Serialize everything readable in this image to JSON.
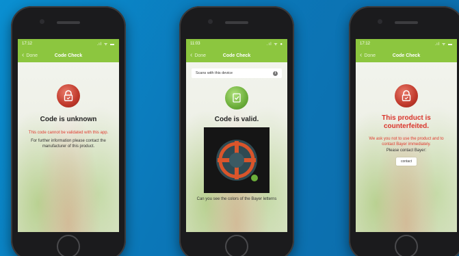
{
  "phones": [
    {
      "status_time": "17:12",
      "status_icons": ".ıl ᯤ ▬",
      "nav_back": "Done",
      "nav_title": "Code Check",
      "badge": "red-lock-icon",
      "title": "Code is unknown",
      "warning": "This code cannot be validated with this app.",
      "info": "For further information please contact the manufacturer of this product."
    },
    {
      "status_time": "11:03",
      "status_icons": ".ıl ᯤ ●",
      "nav_back": "Done",
      "nav_title": "Code Check",
      "scans_label": "Scans with this device",
      "scans_info_icon": "i",
      "badge": "green-check-icon",
      "title": "Code is valid.",
      "bottom_text": "Can you see the colors of the Bayer letterns"
    },
    {
      "status_time": "17:12",
      "status_icons": ".ıl ᯤ ▬",
      "nav_back": "Done",
      "nav_title": "Code Check",
      "badge": "red-lock-icon",
      "title_line1": "This product is",
      "title_line2": "counterfeited.",
      "warning_line1": "We ask you not to use the product and to",
      "warning_line2": "contact Bayer immediately.",
      "info": "Please contact Bayer:",
      "contact_button": "contact"
    }
  ],
  "colors": {
    "background": "#0b77b8",
    "navbar_green": "#8cc63f",
    "alert_red": "#d9342b"
  }
}
